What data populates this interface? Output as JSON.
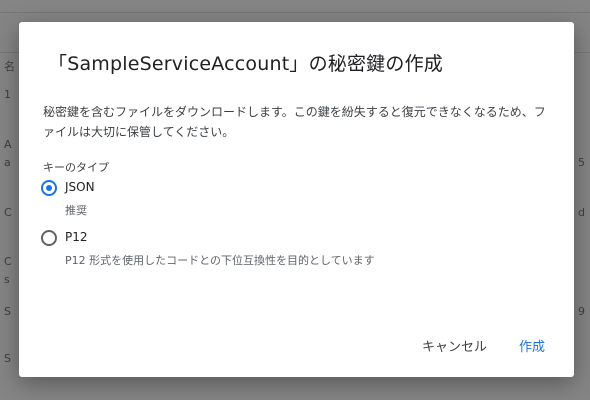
{
  "dialog": {
    "title": "「SampleServiceAccount」の秘密鍵の作成",
    "description": "秘密鍵を含むファイルをダウンロードします。この鍵を紛失すると復元できなくなるため、ファイルは大切に保管してください。",
    "key_type_label": "キーのタイプ",
    "options": [
      {
        "label": "JSON",
        "sub": "推奨",
        "selected": true
      },
      {
        "label": "P12",
        "sub": "P12 形式を使用したコードとの下位互換性を目的としています",
        "selected": false
      }
    ],
    "buttons": {
      "cancel": "キャンセル",
      "create": "作成"
    }
  },
  "background": {
    "left_chars": [
      "名",
      "1",
      "A",
      "a",
      "C",
      "C",
      "s",
      "S",
      "S"
    ],
    "right_chars": [
      "5",
      "d",
      "9"
    ]
  },
  "colors": {
    "accent": "#1a73e8",
    "overlay": "#858585",
    "dialog_bg": "#ffffff"
  }
}
